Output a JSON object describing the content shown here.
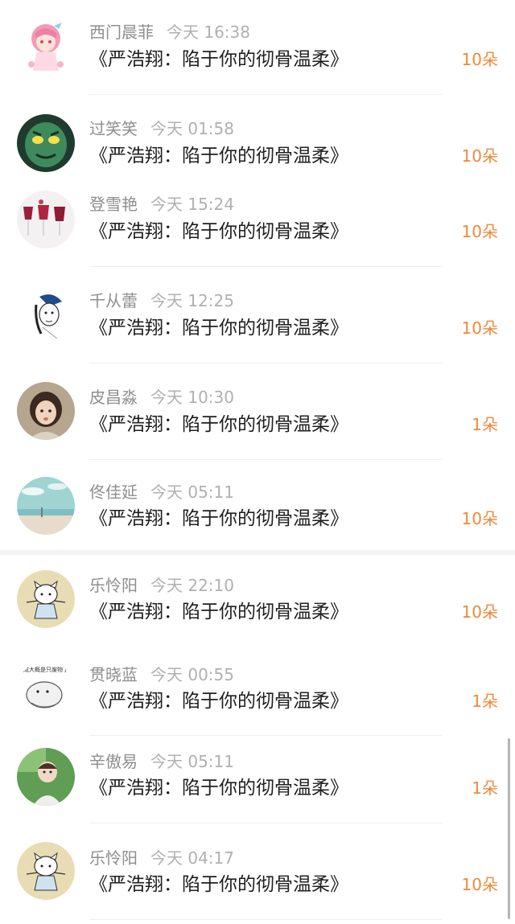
{
  "gift_list": {
    "items": [
      {
        "user": "西门晨菲",
        "time": "今天 16:38",
        "work": "《严浩翔：陷于你的彻骨温柔》",
        "count": "10朵",
        "avatar_icon": "pink-hair-anime-girl-avatar"
      },
      {
        "user": "过笑笑",
        "time": "今天 01:58",
        "work": "《严浩翔：陷于你的彻骨温柔》",
        "count": "10朵",
        "avatar_icon": "green-mask-avatar"
      },
      {
        "user": "登雪艳",
        "time": "今天 15:24",
        "work": "《严浩翔：陷于你的彻骨温柔》",
        "count": "10朵",
        "avatar_icon": "red-wine-glasses-avatar"
      },
      {
        "user": "千从蕾",
        "time": "今天 12:25",
        "work": "《严浩翔：陷于你的彻骨温柔》",
        "count": "10朵",
        "avatar_icon": "sketch-girl-blue-hat-avatar"
      },
      {
        "user": "皮昌淼",
        "time": "今天 10:30",
        "work": "《严浩翔：陷于你的彻骨温柔》",
        "count": "1朵",
        "avatar_icon": "child-photo-avatar"
      },
      {
        "user": "佟佳延",
        "time": "今天 05:11",
        "work": "《严浩翔：陷于你的彻骨温柔》",
        "count": "10朵",
        "avatar_icon": "beach-sky-avatar"
      },
      {
        "user": "乐怜阳",
        "time": "今天 22:10",
        "work": "《严浩翔：陷于你的彻骨温柔》",
        "count": "10朵",
        "avatar_icon": "cartoon-cat-avatar"
      },
      {
        "user": "贯晓蓝",
        "time": "今天 00:55",
        "work": "《严浩翔：陷于你的彻骨温柔》",
        "count": "1朵",
        "avatar_icon": "hamster-meme-avatar",
        "avatar_caption": "成大概是只废物了"
      },
      {
        "user": "辛傲易",
        "time": "今天 05:11",
        "work": "《严浩翔：陷于你的彻骨温柔》",
        "count": "1朵",
        "avatar_icon": "child-green-background-avatar"
      },
      {
        "user": "乐怜阳",
        "time": "今天 04:17",
        "work": "《严浩翔：陷于你的彻骨温柔》",
        "count": "10朵",
        "avatar_icon": "cartoon-cat-avatar"
      }
    ]
  },
  "colors": {
    "accent_count": "#f0893a",
    "name_text": "#8e8e8e",
    "time_text": "#b0b0b0",
    "title_text": "#1f1f1f"
  }
}
